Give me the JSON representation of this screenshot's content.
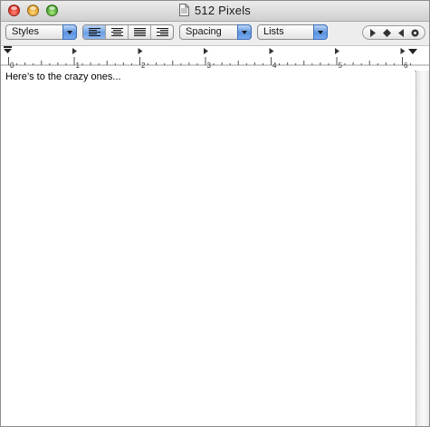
{
  "window": {
    "title": "512 Pixels",
    "icons": {
      "close": "close-icon",
      "minimize": "minimize-icon",
      "zoom": "zoom-icon",
      "document": "document-icon"
    }
  },
  "toolbar": {
    "styles_label": "Styles",
    "spacing_label": "Spacing",
    "lists_label": "Lists",
    "alignment_selected": "left",
    "alignment_icons": [
      "align-left-icon",
      "align-center-icon",
      "align-justify-icon",
      "align-right-icon"
    ],
    "nav_icons": [
      "next-tab-icon",
      "diamond-tab-icon",
      "previous-tab-icon",
      "decimal-tab-icon"
    ]
  },
  "ruler": {
    "unit_labels": [
      "0",
      "1",
      "2",
      "3",
      "4",
      "5",
      "6"
    ]
  },
  "document": {
    "text": "Here’s to the crazy ones..."
  },
  "colors": {
    "accent_blue": "#5b93de",
    "titlebar_top": "#ececec",
    "titlebar_bottom": "#cfcfcf",
    "close": "#d7271c",
    "minimize": "#d9961c",
    "zoom": "#3f9e22"
  }
}
